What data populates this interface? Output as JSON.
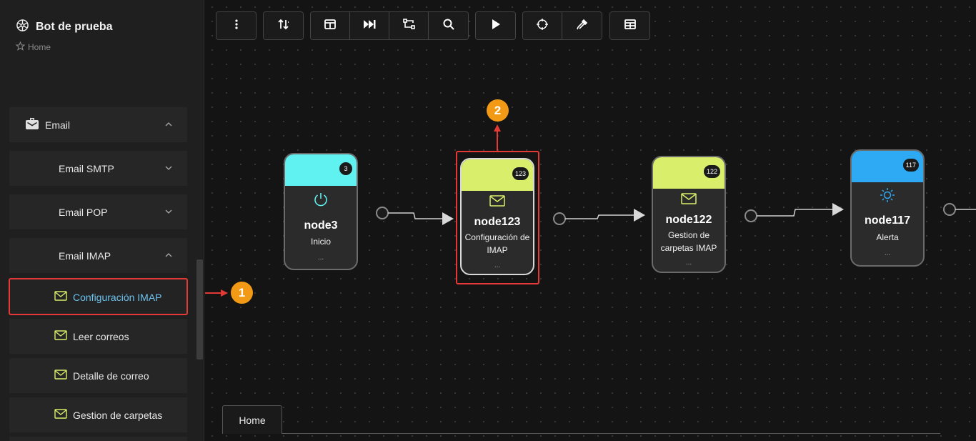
{
  "app": {
    "title": "Bot de prueba",
    "breadcrumb": "Home"
  },
  "sidebar": {
    "email": {
      "label": "Email"
    },
    "smtp": {
      "label": "Email SMTP"
    },
    "pop": {
      "label": "Email POP"
    },
    "imap": {
      "label": "Email IMAP"
    },
    "items": [
      {
        "label": "Configuración IMAP",
        "active": true
      },
      {
        "label": "Leer correos"
      },
      {
        "label": "Detalle de correo"
      },
      {
        "label": "Gestion de carpetas"
      }
    ]
  },
  "toolbar": {
    "groups": [
      [
        "more-vert-icon"
      ],
      [
        "sort-icon"
      ],
      [
        "panel-icon",
        "skip-forward-icon",
        "route-icon",
        "search-icon"
      ],
      [
        "play-icon"
      ],
      [
        "crosshair-icon",
        "eyedropper-icon"
      ],
      [
        "table-icon"
      ]
    ]
  },
  "nodes": [
    {
      "id": "node3",
      "name": "node3",
      "desc": "Inicio",
      "badge": "3",
      "more": "...",
      "icon": "power-icon",
      "color": "#5ff2f0"
    },
    {
      "id": "node123",
      "name": "node123",
      "desc": "Configuración de IMAP",
      "badge": "123",
      "more": "...",
      "icon": "mail-icon",
      "color": "#d9ee6a"
    },
    {
      "id": "node122",
      "name": "node122",
      "desc": "Gestion de carpetas IMAP",
      "badge": "122",
      "more": "...",
      "icon": "mail-icon",
      "color": "#d9ee6a"
    },
    {
      "id": "node117",
      "name": "node117",
      "desc": "Alerta",
      "badge": "117",
      "more": "...",
      "icon": "sun-icon",
      "color": "#2ea9f3"
    }
  ],
  "markers": {
    "one": "1",
    "two": "2"
  },
  "tabs": [
    {
      "label": "Home"
    }
  ],
  "colors": {
    "highlight": "#e53935",
    "marker": "#f29a16",
    "active_link": "#6cc3f0",
    "mail_icon": "#d9ee6a"
  }
}
